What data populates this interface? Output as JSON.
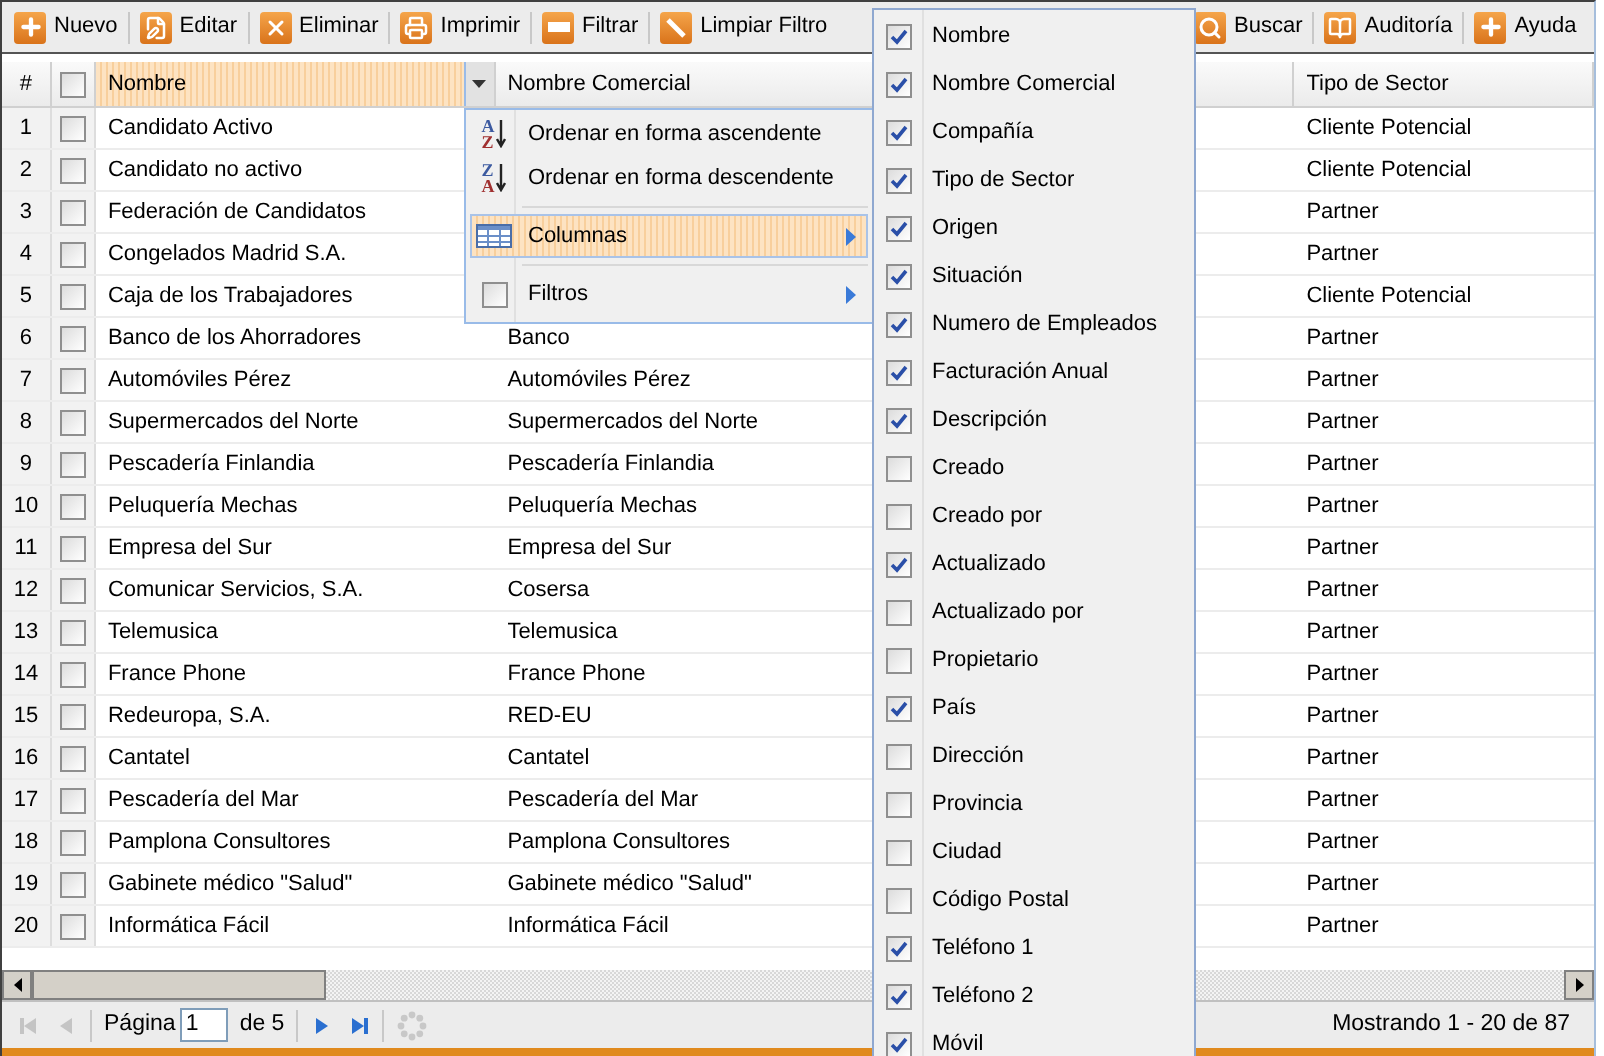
{
  "toolbar": {
    "left": [
      {
        "kind": "new",
        "label": "Nuevo"
      },
      {
        "kind": "edit",
        "label": "Editar"
      },
      {
        "kind": "delete",
        "label": "Eliminar"
      },
      {
        "kind": "print",
        "label": "Imprimir"
      },
      {
        "kind": "filter",
        "label": "Filtrar"
      },
      {
        "kind": "clear",
        "label": "Limpiar Filtro"
      }
    ],
    "right": [
      {
        "kind": "search",
        "label": "Buscar"
      },
      {
        "kind": "audit",
        "label": "Auditoría"
      },
      {
        "kind": "help",
        "label": "Ayuda"
      }
    ]
  },
  "grid": {
    "number_header": "#",
    "select_all": {
      "checked": false
    },
    "columns": [
      {
        "label": "Nombre",
        "selected": true
      },
      {
        "label": "Nombre Comercial",
        "selected": false
      },
      {
        "label": "Tipo de Sector",
        "selected": false
      }
    ],
    "rows": [
      {
        "number": "1",
        "checked": false,
        "nombre": "Candidato Activo",
        "tipo": "Cliente Potencial"
      },
      {
        "number": "2",
        "checked": false,
        "nombre": "Candidato no activo",
        "tipo": "Cliente Potencial"
      },
      {
        "number": "3",
        "checked": false,
        "nombre": "Federación de Candidatos",
        "tipo": "Partner"
      },
      {
        "number": "4",
        "checked": false,
        "nombre": "Congelados Madrid S.A.",
        "tipo": "Partner"
      },
      {
        "number": "5",
        "checked": false,
        "nombre": "Caja de los Trabajadores",
        "tipo": "Cliente Potencial"
      },
      {
        "number": "6",
        "checked": false,
        "nombre": "Banco de los Ahorradores",
        "comercial": "Banco",
        "tipo": "Partner"
      },
      {
        "number": "7",
        "checked": false,
        "nombre": "Automóviles Pérez",
        "comercial": "Automóviles Pérez",
        "tipo": "Partner"
      },
      {
        "number": "8",
        "checked": false,
        "nombre": "Supermercados del Norte",
        "comercial": "Supermercados del Norte",
        "tipo": "Partner"
      },
      {
        "number": "9",
        "checked": false,
        "nombre": "Pescadería Finlandia",
        "comercial": "Pescadería Finlandia",
        "tipo": "Partner"
      },
      {
        "number": "10",
        "checked": false,
        "nombre": "Peluquería Mechas",
        "comercial": "Peluquería Mechas",
        "tipo": "Partner"
      },
      {
        "number": "11",
        "checked": false,
        "nombre": "Empresa del Sur",
        "comercial": "Empresa del Sur",
        "tipo": "Partner"
      },
      {
        "number": "12",
        "checked": false,
        "nombre": "Comunicar Servicios, S.A.",
        "comercial": "Cosersa",
        "tipo": "Partner"
      },
      {
        "number": "13",
        "checked": false,
        "nombre": "Telemusica",
        "comercial": "Telemusica",
        "tipo": "Partner"
      },
      {
        "number": "14",
        "checked": false,
        "nombre": "France Phone",
        "comercial": "France Phone",
        "tipo": "Partner"
      },
      {
        "number": "15",
        "checked": false,
        "nombre": "Redeuropa, S.A.",
        "comercial": "RED-EU",
        "tipo": "Partner"
      },
      {
        "number": "16",
        "checked": false,
        "nombre": "Cantatel",
        "comercial": "Cantatel",
        "tipo": "Partner"
      },
      {
        "number": "17",
        "checked": false,
        "nombre": "Pescadería del Mar",
        "comercial": "Pescadería del Mar",
        "tipo": "Partner"
      },
      {
        "number": "18",
        "checked": false,
        "nombre": "Pamplona Consultores",
        "comercial": "Pamplona Consultores",
        "tipo": "Partner"
      },
      {
        "number": "19",
        "checked": false,
        "nombre": "Gabinete médico \"Salud\"",
        "comercial": "Gabinete médico \"Salud\"",
        "tipo": "Partner"
      },
      {
        "number": "20",
        "checked": false,
        "nombre": "Informática Fácil",
        "comercial": "Informática Fácil",
        "tipo": "Partner"
      }
    ]
  },
  "column_menu": {
    "items": [
      {
        "kind": "sort",
        "label": "Ordenar en forma ascendente",
        "icon_top": "A",
        "icon_bottom": "Z",
        "selected": false
      },
      {
        "kind": "sort",
        "label": "Ordenar en forma descendente",
        "icon_top": "Z",
        "icon_bottom": "A",
        "selected": false
      },
      {
        "kind": "columns",
        "label": "Columnas",
        "selected": true
      },
      {
        "kind": "filters",
        "label": "Filtros",
        "checked": false,
        "selected": false
      }
    ]
  },
  "columns_submenu": [
    {
      "label": "Nombre",
      "checked": true
    },
    {
      "label": "Nombre Comercial",
      "checked": true
    },
    {
      "label": "Compañía",
      "checked": true
    },
    {
      "label": "Tipo de Sector",
      "checked": true
    },
    {
      "label": "Origen",
      "checked": true
    },
    {
      "label": "Situación",
      "checked": true
    },
    {
      "label": "Numero de Empleados",
      "checked": true
    },
    {
      "label": "Facturación Anual",
      "checked": true
    },
    {
      "label": "Descripción",
      "checked": true
    },
    {
      "label": "Creado",
      "checked": false
    },
    {
      "label": "Creado por",
      "checked": false
    },
    {
      "label": "Actualizado",
      "checked": true
    },
    {
      "label": "Actualizado por",
      "checked": false
    },
    {
      "label": "Propietario",
      "checked": false
    },
    {
      "label": "País",
      "checked": true
    },
    {
      "label": "Dirección",
      "checked": false
    },
    {
      "label": "Provincia",
      "checked": false
    },
    {
      "label": "Ciudad",
      "checked": false
    },
    {
      "label": "Código Postal",
      "checked": false
    },
    {
      "label": "Teléfono 1",
      "checked": true
    },
    {
      "label": "Teléfono 2",
      "checked": true
    },
    {
      "label": "Móvil",
      "checked": true
    }
  ],
  "paging": {
    "first_disabled": true,
    "prev_disabled": true,
    "page_label": "Página",
    "page": "1",
    "of_label": "de 5",
    "status": "Mostrando 1 - 20 de 87"
  }
}
